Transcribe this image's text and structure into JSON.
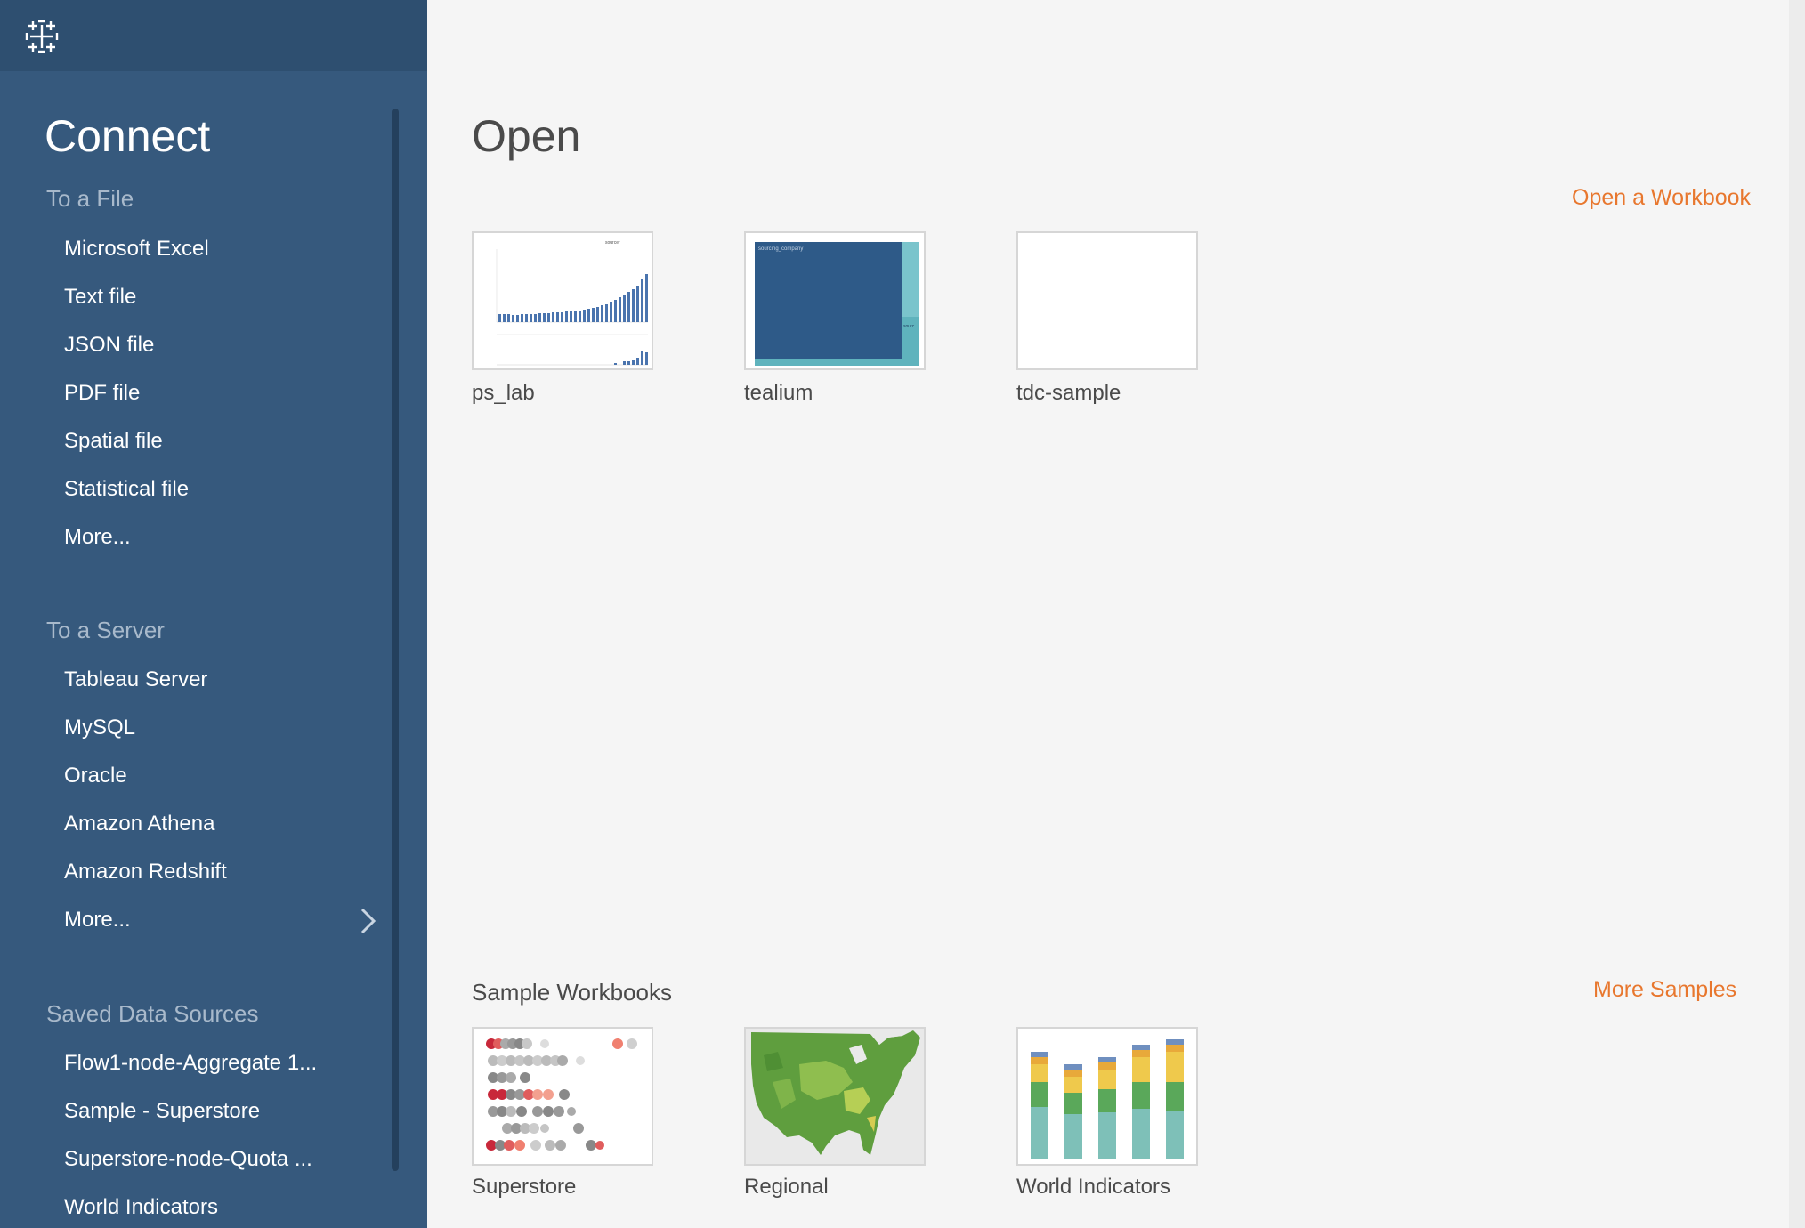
{
  "sidebar": {
    "title": "Connect",
    "sections": [
      {
        "heading": "To a File",
        "items": [
          "Microsoft Excel",
          "Text file",
          "JSON file",
          "PDF file",
          "Spatial file",
          "Statistical file",
          "More..."
        ]
      },
      {
        "heading": "To a Server",
        "items": [
          "Tableau Server",
          "MySQL",
          "Oracle",
          "Amazon Athena",
          "Amazon Redshift",
          "More..."
        ]
      },
      {
        "heading": "Saved Data Sources",
        "items": [
          "Flow1-node-Aggregate 1...",
          "Sample - Superstore",
          "Superstore-node-Quota ...",
          "World Indicators"
        ]
      }
    ]
  },
  "main": {
    "title": "Open",
    "open_link": "Open a Workbook",
    "workbooks": [
      {
        "label": "ps_lab",
        "thumb_text": "sourcer"
      },
      {
        "label": "tealium",
        "thumb_text": "sourcing_company",
        "thumb_side_text": "sourc"
      },
      {
        "label": "tdc-sample"
      }
    ],
    "samples_title": "Sample Workbooks",
    "samples_link": "More Samples",
    "samples": [
      {
        "label": "Superstore"
      },
      {
        "label": "Regional"
      },
      {
        "label": "World Indicators"
      }
    ]
  },
  "icons": {
    "logo": "tableau-logo-icon",
    "more_servers": "chevron-right-icon"
  },
  "colors": {
    "sidebar_bg": "#36597d",
    "accent": "#e8772e",
    "tealium_blue": "#2e5a88",
    "tealium_teal": "#7ac4cc"
  }
}
